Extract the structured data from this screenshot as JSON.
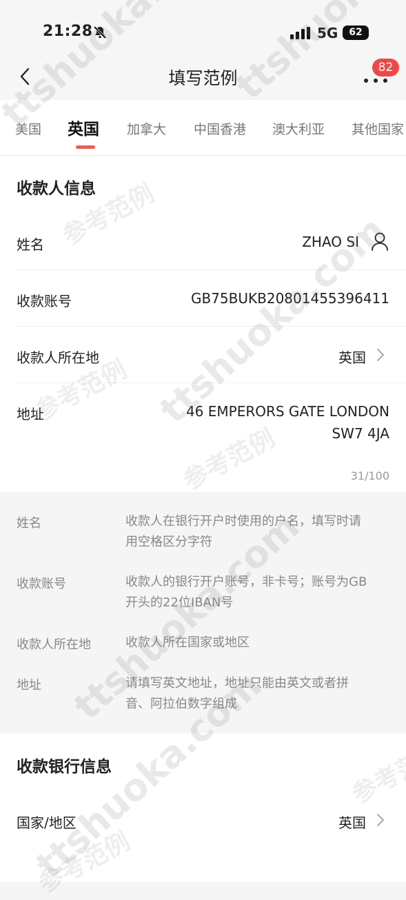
{
  "status": {
    "time": "21:28",
    "network": "5G",
    "battery": "62"
  },
  "nav": {
    "title": "填写范例",
    "badge": "82"
  },
  "tabs": [
    "美国",
    "英国",
    "加拿大",
    "中国香港",
    "澳大利亚",
    "其他国家"
  ],
  "active_tab": "英国",
  "payee": {
    "section_title": "收款人信息",
    "rows": [
      {
        "label": "姓名",
        "value": "ZHAO SI"
      },
      {
        "label": "收款账号",
        "value": "GB75BUKB20801455396411"
      },
      {
        "label": "收款人所在地",
        "value": "英国"
      },
      {
        "label": "地址",
        "value_line1": "46 EMPERORS GATE LONDON",
        "value_line2": "SW7 4JA"
      }
    ],
    "counter": "31/100"
  },
  "help": [
    {
      "label": "姓名",
      "line1": "收款人在银行开户时使用的户名，填写时请",
      "line2": "用空格区分字符"
    },
    {
      "label": "收款账号",
      "line1": "收款人的银行开户账号，非卡号；账号为GB",
      "line2": "开头的22位IBAN号"
    },
    {
      "label": "收款人所在地",
      "line1": "收款人所在国家或地区",
      "line2": ""
    },
    {
      "label": "地址",
      "line1": "请填写英文地址，地址只能由英文或者拼",
      "line2": "音、阿拉伯数字组成"
    }
  ],
  "bank": {
    "section_title": "收款银行信息",
    "rows": [
      {
        "label": "国家/地区",
        "value": "英国"
      }
    ]
  },
  "watermarks": {
    "site": "ttshuoka.com",
    "sample": "参考范例"
  },
  "colors": {
    "accent": "#ef5b5b",
    "badge": "#f04848"
  }
}
